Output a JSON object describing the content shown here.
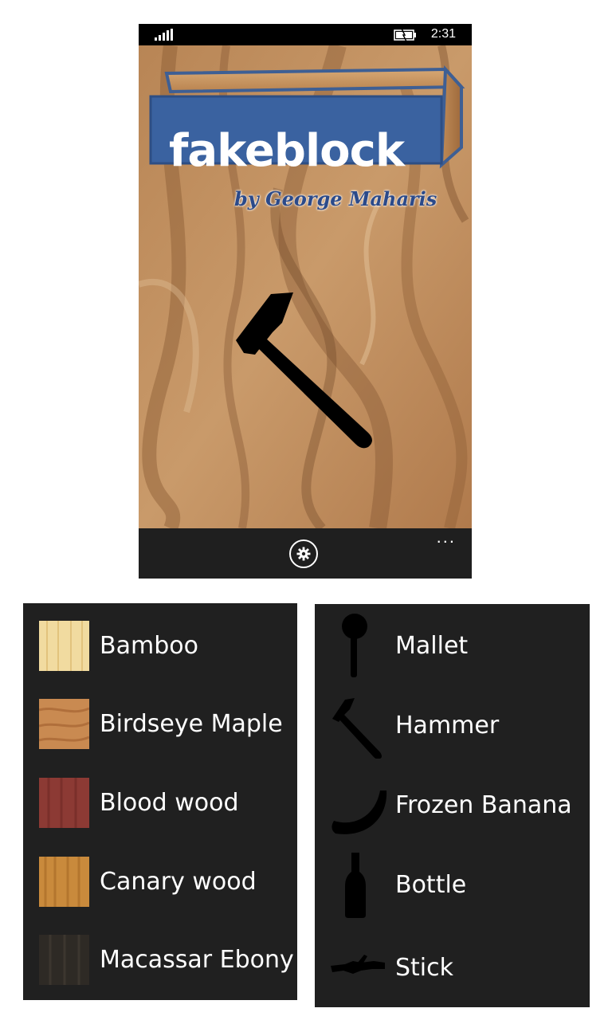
{
  "status_bar": {
    "time": "2:31"
  },
  "logo": {
    "title": "fakeblock",
    "byline": "by George Maharis"
  },
  "app_bar": {
    "settings_icon": "gear-icon",
    "more_label": "..."
  },
  "woods": [
    {
      "label": "Bamboo",
      "color": "#f1dba0"
    },
    {
      "label": "Birdseye Maple",
      "color": "#c98a51"
    },
    {
      "label": "Blood wood",
      "color": "#8c3a34"
    },
    {
      "label": "Canary wood",
      "color": "#c98a3c"
    },
    {
      "label": "Macassar Ebony",
      "color": "#2e2a25"
    }
  ],
  "tools": [
    {
      "label": "Mallet",
      "icon": "mallet-icon"
    },
    {
      "label": "Hammer",
      "icon": "hammer-icon"
    },
    {
      "label": "Frozen Banana",
      "icon": "banana-icon"
    },
    {
      "label": "Bottle",
      "icon": "bottle-icon"
    },
    {
      "label": "Stick",
      "icon": "stick-icon"
    }
  ]
}
